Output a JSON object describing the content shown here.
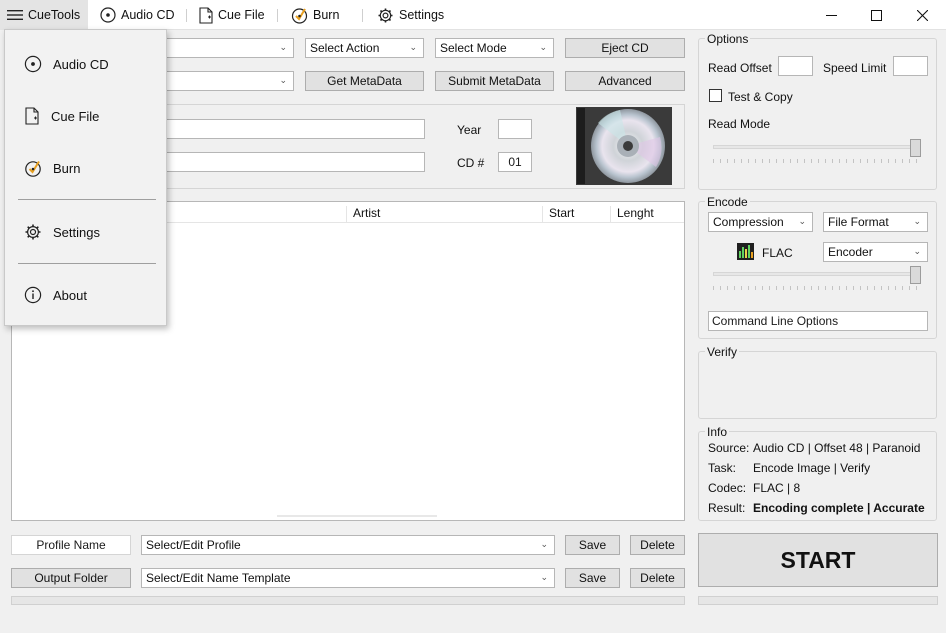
{
  "topbar": {
    "items": [
      {
        "label": "CueTools",
        "icon": "hamburger-menu-icon"
      },
      {
        "label": "Audio CD",
        "icon": "disc-icon"
      },
      {
        "label": "Cue File",
        "icon": "document-icon"
      },
      {
        "label": "Burn",
        "icon": "burn-disc-icon"
      },
      {
        "label": "Settings",
        "icon": "gear-icon"
      }
    ]
  },
  "toolbar": {
    "select_action": "Select Action",
    "select_mode": "Select Mode",
    "eject_cd": "Eject CD",
    "get_metadata": "Get MetaData",
    "submit_metadata": "Submit MetaData",
    "advanced": "Advanced"
  },
  "album": {
    "year_label": "Year",
    "year_value": "",
    "cd_label": "CD #",
    "cd_value": "01"
  },
  "tracks": {
    "columns": [
      "Artist",
      "Start",
      "Lenght"
    ],
    "rows": []
  },
  "profile": {
    "label": "Profile Name",
    "placeholder": "Select/Edit Profile",
    "save": "Save",
    "delete": "Delete"
  },
  "output": {
    "label": "Output Folder",
    "placeholder": "Select/Edit Name Template",
    "save": "Save",
    "delete": "Delete"
  },
  "options": {
    "title": "Options",
    "read_offset_label": "Read Offset",
    "read_offset_value": "",
    "speed_limit_label": "Speed Limit",
    "speed_limit_value": "",
    "test_copy_label": "Test & Copy",
    "test_copy_checked": false,
    "read_mode_label": "Read Mode",
    "read_mode_level": 1.0
  },
  "encode": {
    "title": "Encode",
    "compression": "Compression",
    "file_format": "File Format",
    "codec_name": "FLAC",
    "encoder": "Encoder",
    "compression_level": 1.0,
    "command_line_placeholder": "Command Line Options"
  },
  "verify": {
    "title": "Verify"
  },
  "info": {
    "title": "Info",
    "rows": [
      {
        "key": "Source:",
        "value": "Audio CD | Offset 48 | Paranoid"
      },
      {
        "key": "Task:",
        "value": "Encode Image | Verify"
      },
      {
        "key": "Codec:",
        "value": "FLAC | 8"
      },
      {
        "key": "Result:",
        "value": "Encoding complete | Accurate"
      }
    ]
  },
  "start_label": "START",
  "side_menu": {
    "items": [
      {
        "label": "Audio CD",
        "icon": "disc-icon"
      },
      {
        "label": "Cue File",
        "icon": "document-icon"
      },
      {
        "label": "Burn",
        "icon": "burn-disc-icon"
      },
      {
        "label": "Settings",
        "icon": "gear-icon"
      },
      {
        "label": "About",
        "icon": "info-icon"
      }
    ]
  },
  "colors": {
    "button_bg": "#e1e1e1",
    "window_bg": "#f0f0f0",
    "accent_orange": "#e8a020"
  }
}
